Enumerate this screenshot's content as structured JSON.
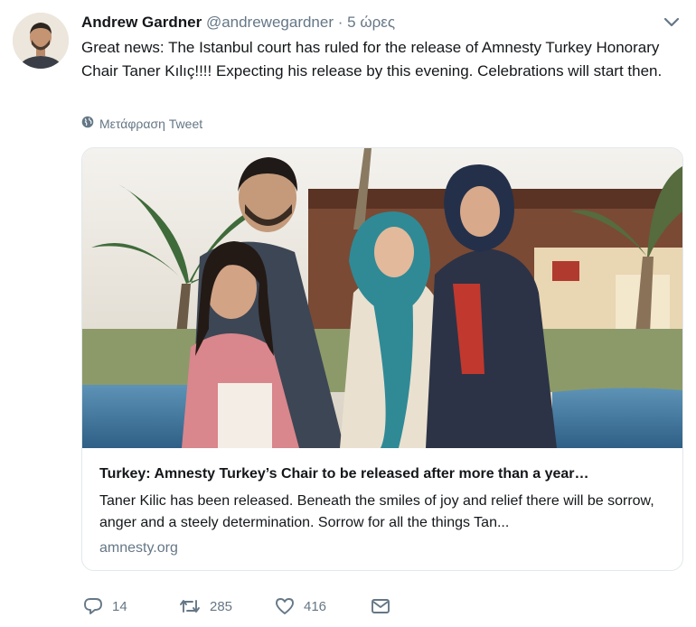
{
  "tweet": {
    "author_name": "Andrew Gardner",
    "handle": "@andrewegardner",
    "separator": "·",
    "time": "5 ώρες",
    "text": "Great news: The Istanbul court has ruled for the release of Amnesty Turkey Honorary Chair Taner Kılıç!!!! Expecting his release by this evening. Celebrations will start then.",
    "translate_label": "Μετάφραση Tweet"
  },
  "card": {
    "title": "Turkey: Amnesty Turkey’s Chair to be released after more than a year…",
    "description": "Taner Kilic has been released. Beneath the smiles of joy and relief there will be sorrow, anger and a steely determination. Sorrow for all the things Tan...",
    "domain": "amnesty.org"
  },
  "actions": {
    "replies": "14",
    "retweets": "285",
    "likes": "416"
  },
  "icons": [
    "globe-icon",
    "chevron-down-icon",
    "reply-icon",
    "retweet-icon",
    "like-icon",
    "message-icon"
  ],
  "colors": {
    "text": "#14171a",
    "secondary": "#657786",
    "border": "#e1e8ed"
  }
}
